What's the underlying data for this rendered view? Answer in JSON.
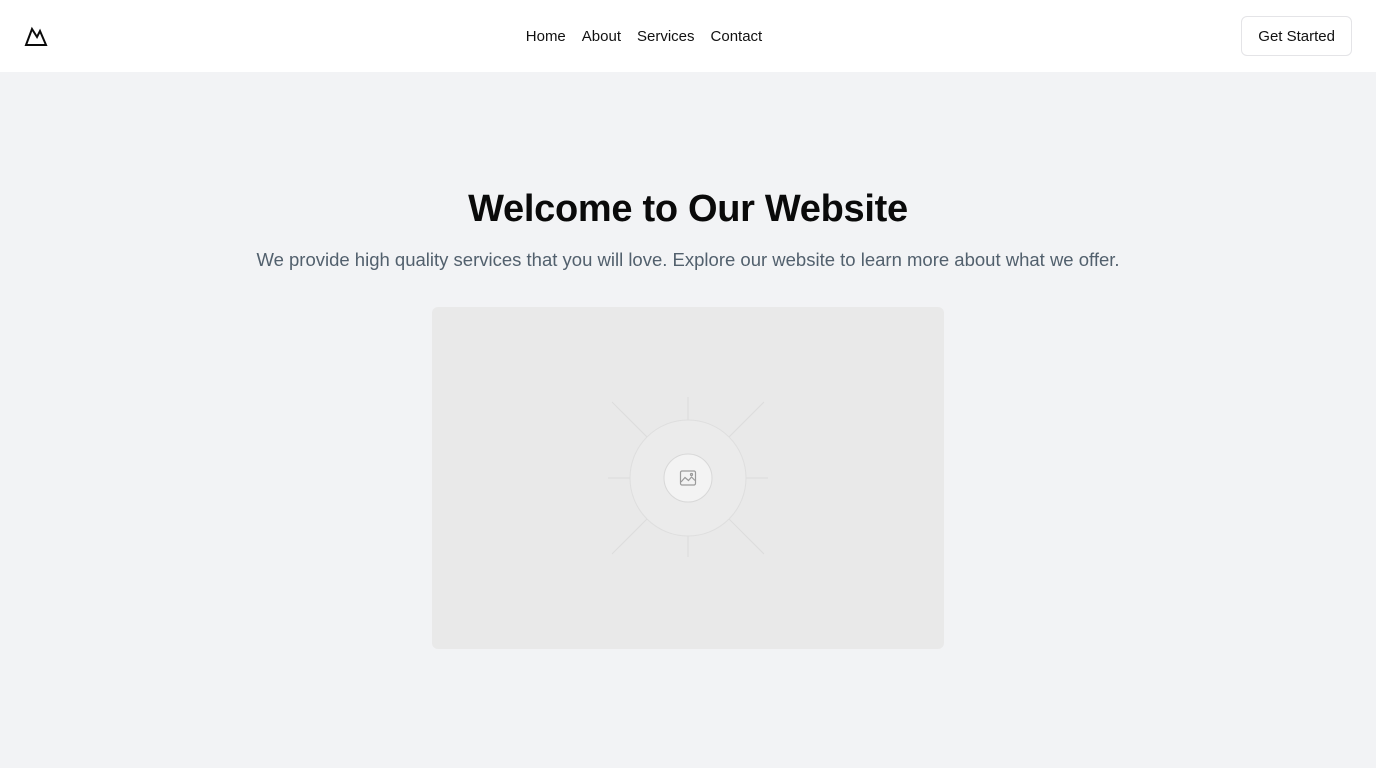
{
  "header": {
    "logo_icon": "mountain-logo-icon",
    "nav": [
      {
        "label": "Home"
      },
      {
        "label": "About"
      },
      {
        "label": "Services"
      },
      {
        "label": "Contact"
      }
    ],
    "cta_label": "Get Started"
  },
  "hero": {
    "title": "Welcome to Our Website",
    "subtitle": "We provide high quality services that you will love. Explore our website to learn more about what we offer.",
    "image_icon": "image-placeholder-icon"
  },
  "colors": {
    "page_background": "#f2f3f5",
    "header_background": "#ffffff",
    "subtitle_text": "#52606d",
    "placeholder_background": "#e9e9e9"
  }
}
